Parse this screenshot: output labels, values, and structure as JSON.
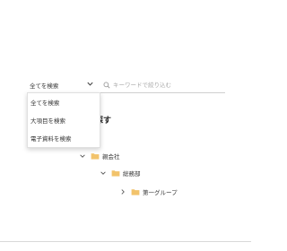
{
  "search_bar": {
    "scope_selected": "全てを検索",
    "placeholder": "キーワードで絞り込む"
  },
  "dropdown": {
    "options": [
      "全てを検索",
      "大項目を検索",
      "電子資料を検索"
    ]
  },
  "main": {
    "heading_partial": "探す"
  },
  "tree": {
    "items": [
      {
        "label": "親会社",
        "expanded": true
      },
      {
        "label": "総務部",
        "expanded": true
      },
      {
        "label": "第一グループ",
        "expanded": false
      }
    ]
  },
  "colors": {
    "folder": "#f2c36b",
    "border": "#d9d9d9"
  },
  "icons": {
    "search": "search-icon",
    "chevron_down": "chevron-down-icon",
    "chevron_right": "chevron-right-icon",
    "folder": "folder-icon"
  }
}
